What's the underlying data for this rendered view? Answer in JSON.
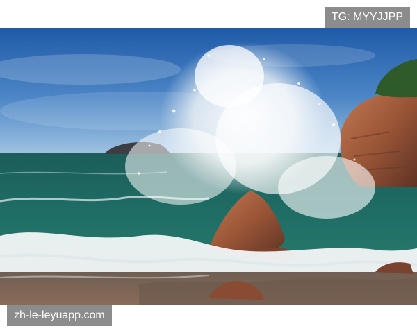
{
  "watermarks": {
    "top_right": "TG: MYYJJPP",
    "bottom_left": "zh-le-leyuapp.com"
  },
  "scene": {
    "sky_top": "#1f5aa8",
    "sky_bottom": "#8fb6da",
    "sea_color": "#1f6b66",
    "foam_color": "#f4f6f7",
    "rock_color": "#8b4d34",
    "sand_color": "#7e6857"
  }
}
